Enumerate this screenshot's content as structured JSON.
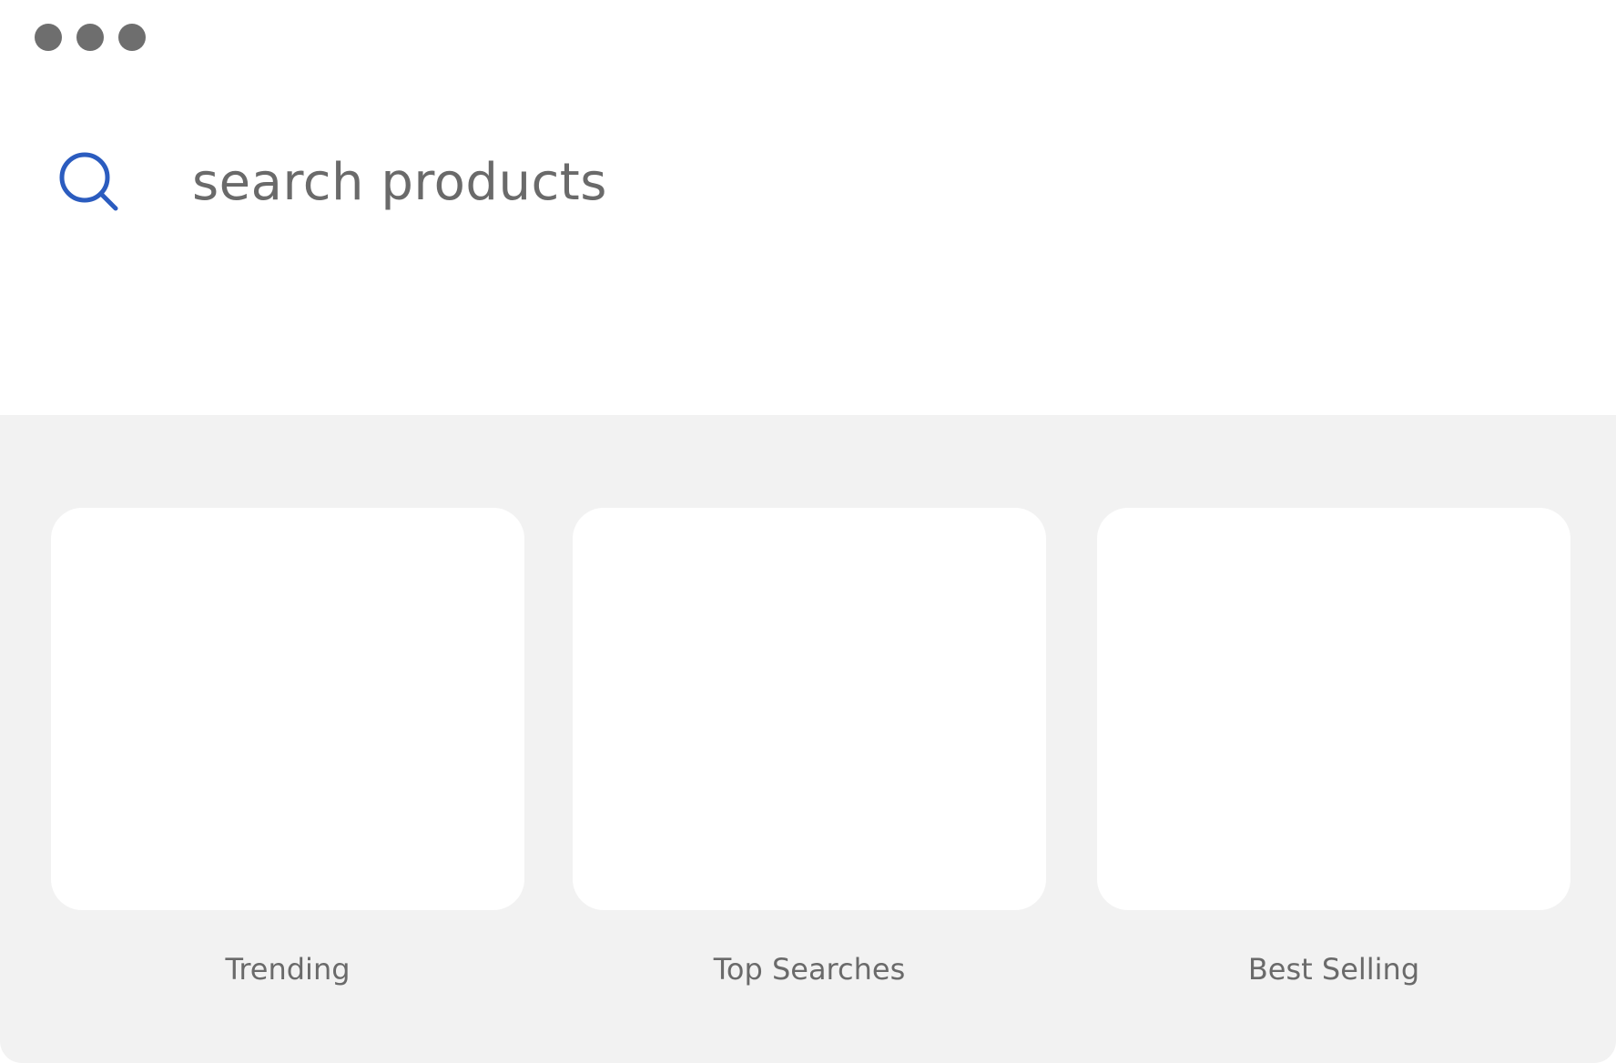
{
  "window": {
    "controls": [
      "dot",
      "dot",
      "dot"
    ]
  },
  "search": {
    "icon": "search-icon",
    "placeholder": "search products",
    "value": "",
    "accent_color": "#2b5cbf"
  },
  "categories": [
    {
      "label": "Trending"
    },
    {
      "label": "Top Searches"
    },
    {
      "label": "Best Selling"
    }
  ],
  "colors": {
    "background": "#ffffff",
    "panel": "#f2f2f2",
    "card": "#ffffff",
    "text": "#6a6a6a",
    "window_dots": "#6e6e6e"
  }
}
